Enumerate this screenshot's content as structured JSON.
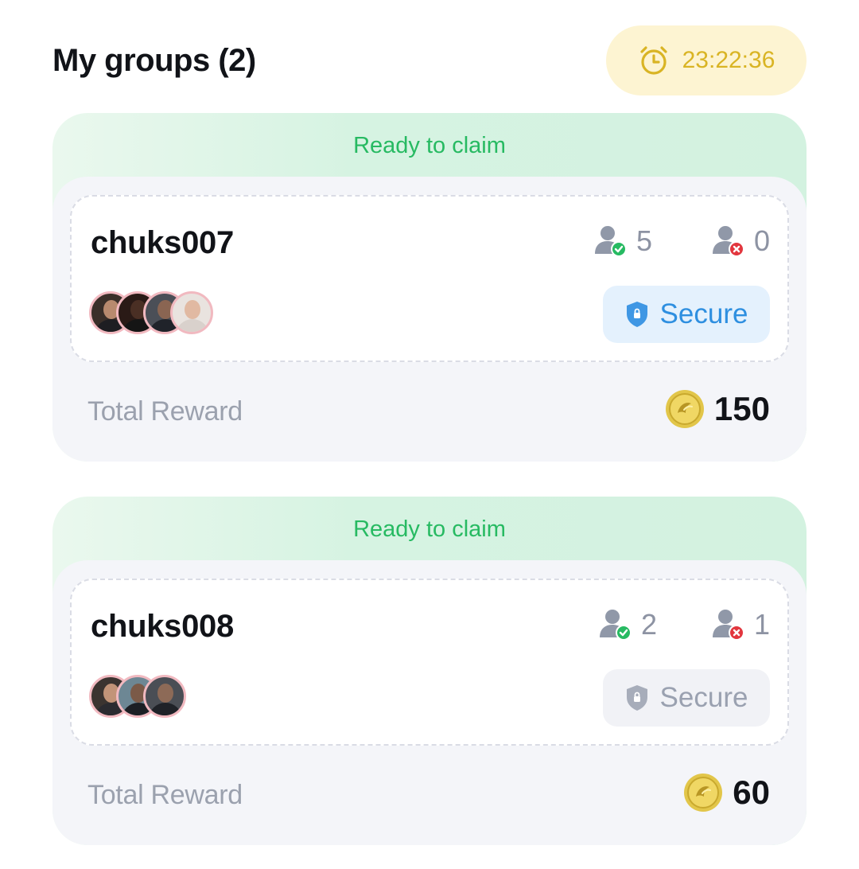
{
  "header": {
    "title": "My groups (2)",
    "timer": "23:22:36",
    "timer_icon": "alarm-clock-icon"
  },
  "colors": {
    "status_green": "#27ba62",
    "timer_yellow": "#d9b424",
    "secure_blue": "#2e8fe0",
    "muted_gray": "#9ba1ae"
  },
  "groups": [
    {
      "status": "Ready to claim",
      "name": "chuks007",
      "joined_count": "5",
      "rejected_count": "0",
      "avatar_count": 4,
      "secure_label": "Secure",
      "secure_active": true,
      "reward_label": "Total Reward",
      "reward_value": "150"
    },
    {
      "status": "Ready to claim",
      "name": "chuks008",
      "joined_count": "2",
      "rejected_count": "1",
      "avatar_count": 3,
      "secure_label": "Secure",
      "secure_active": false,
      "reward_label": "Total Reward",
      "reward_value": "60"
    }
  ]
}
